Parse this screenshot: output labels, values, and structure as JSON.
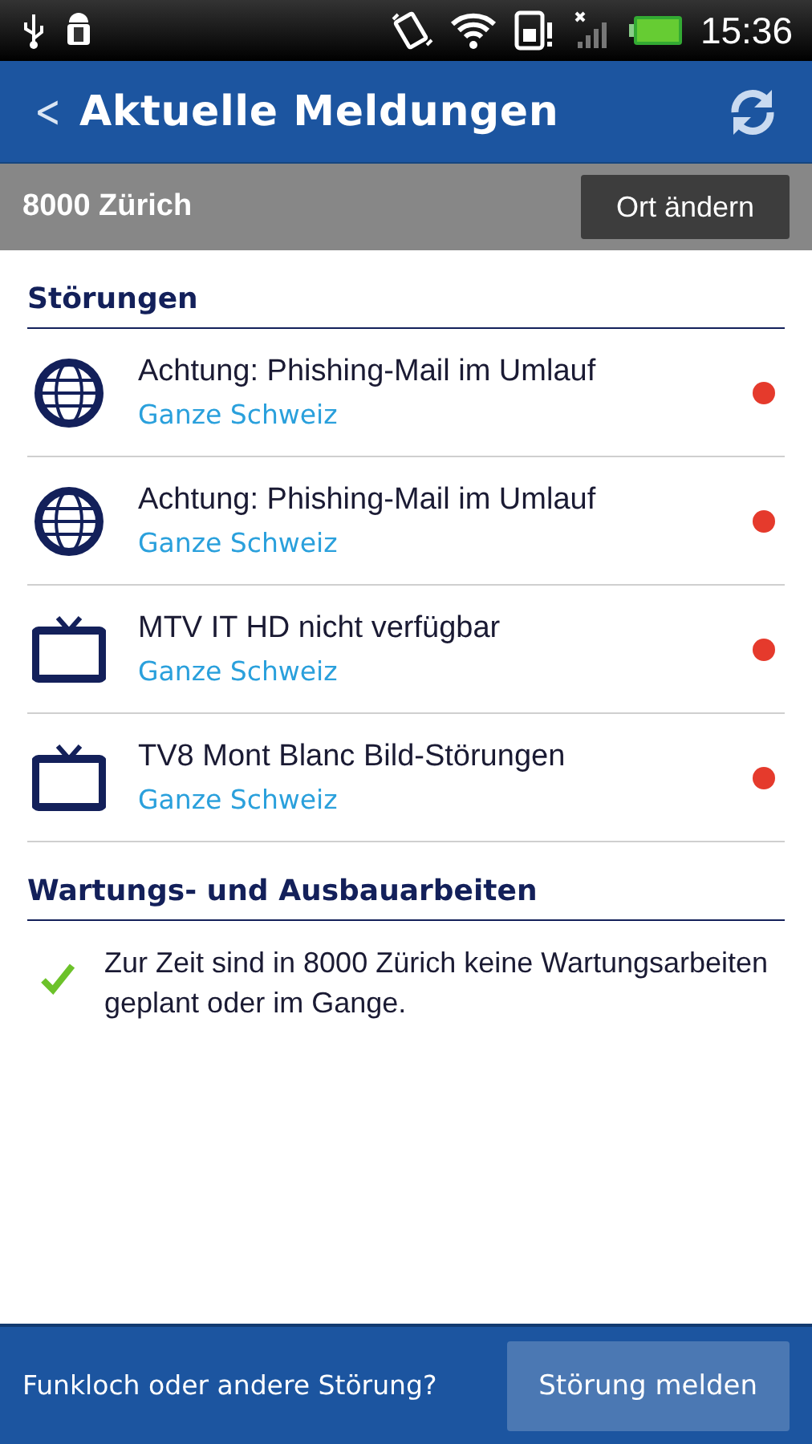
{
  "status_bar": {
    "time": "15:36"
  },
  "header": {
    "back": "<",
    "title": "Aktuelle Meldungen"
  },
  "location": {
    "place": "8000 Zürich",
    "button": "Ort ändern"
  },
  "sections": [
    {
      "title": "Störungen",
      "items": [
        {
          "kind": "globe",
          "title": "Achtung: Phishing-Mail im Umlauf",
          "area": "Ganze Schweiz",
          "color": "#e53a2c"
        },
        {
          "kind": "globe",
          "title": "Achtung: Phishing-Mail im Umlauf",
          "area": "Ganze Schweiz",
          "color": "#e53a2c"
        },
        {
          "kind": "tv",
          "title": "MTV IT HD nicht verfügbar",
          "area": "Ganze Schweiz",
          "color": "#e53a2c"
        },
        {
          "kind": "tv",
          "title": "TV8 Mont Blanc Bild-Störungen",
          "area": "Ganze Schweiz",
          "color": "#e53a2c"
        }
      ]
    },
    {
      "title": "Wartungs- und Ausbauarbeiten",
      "note": "Zur Zeit sind in 8000 Zürich keine Wartungsarbeiten geplant oder im Gange."
    }
  ],
  "footer": {
    "question": "Funkloch oder andere Störung?",
    "button": "Störung melden"
  }
}
